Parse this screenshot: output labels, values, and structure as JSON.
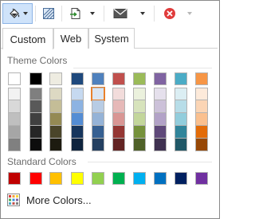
{
  "toolbar": {
    "buttons": [
      {
        "name": "fill-color-button",
        "icon": "paint-bucket-icon"
      },
      {
        "name": "pattern-button",
        "icon": "hatch-pattern-icon"
      },
      {
        "name": "insert-button",
        "icon": "insert-page-icon"
      },
      {
        "name": "email-button",
        "icon": "envelope-icon"
      },
      {
        "name": "delete-button",
        "icon": "delete-icon"
      }
    ]
  },
  "tabs": [
    {
      "label": "Custom",
      "active": true
    },
    {
      "label": "Web",
      "active": false
    },
    {
      "label": "System",
      "active": false
    }
  ],
  "theme": {
    "title": "Theme Colors",
    "top": [
      "#ffffff",
      "#000000",
      "#eeece1",
      "#1f497d",
      "#4f81bd",
      "#c0504d",
      "#9bbb59",
      "#8064a2",
      "#4bacc6",
      "#f79646"
    ],
    "shades": [
      [
        "#f2f2f2",
        "#d9d9d9",
        "#bfbfbf",
        "#a6a6a6",
        "#808080"
      ],
      [
        "#7f7f7f",
        "#595959",
        "#404040",
        "#262626",
        "#0d0d0d"
      ],
      [
        "#ddd9c3",
        "#c4bd97",
        "#948a54",
        "#4a452a",
        "#1d1b10"
      ],
      [
        "#c6d9f0",
        "#8db3e2",
        "#548dd4",
        "#17365d",
        "#0f243e"
      ],
      [
        "#dbe5f1",
        "#b8cce4",
        "#95b3d7",
        "#366092",
        "#244061"
      ],
      [
        "#f2dcdb",
        "#e6b9b8",
        "#d99694",
        "#953734",
        "#632423"
      ],
      [
        "#ebf1dd",
        "#d7e3bc",
        "#c3d69b",
        "#76923c",
        "#4f6128"
      ],
      [
        "#e5e0ec",
        "#ccc1d9",
        "#b2a2c7",
        "#5f497a",
        "#3f3151"
      ],
      [
        "#dbeef3",
        "#b7dde8",
        "#92cddc",
        "#31859b",
        "#205867"
      ],
      [
        "#fdeada",
        "#fbd5b5",
        "#fac08f",
        "#e36c09",
        "#974806"
      ]
    ],
    "selected": {
      "column": 4,
      "row": 0
    }
  },
  "standard": {
    "title": "Standard Colors",
    "colors": [
      "#c00000",
      "#ff0000",
      "#ffc000",
      "#ffff00",
      "#92d050",
      "#00b050",
      "#00b0f0",
      "#0070c0",
      "#002060",
      "#7030a0"
    ]
  },
  "more_colors": {
    "label": "More Colors..."
  }
}
